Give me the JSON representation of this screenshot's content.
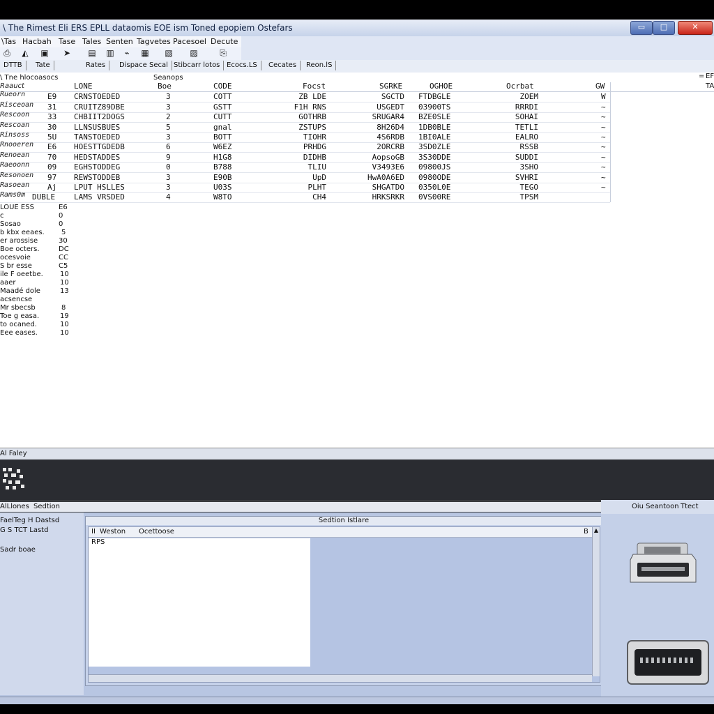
{
  "window": {
    "title": "\\ The Rimest Eli ERS EPLL dataomis EOE ism Toned epopiem Ostefars",
    "buttons": {
      "minimize": "▭",
      "maximize": "□",
      "close": "✕"
    }
  },
  "menu": [
    "\\Tas",
    "Hacbah",
    "Tase",
    "Tales",
    "Senten",
    "Tagvetes",
    "Pacesoel",
    "Decute"
  ],
  "toolbar_icons": [
    "print-icon",
    "pointer-icon",
    "image-icon",
    "arrow-icon",
    "screen-icon",
    "scan-icon",
    "graph-icon",
    "chart-icon",
    "printer-icon"
  ],
  "tabs": [
    "DTTB",
    "Tate",
    "Rates",
    "Dispace Secal",
    "Stibcarr lotos",
    "Ecocs.LS",
    "Cecates",
    "Reon.lS"
  ],
  "header": {
    "left": "\\ Tne hlocoasocs",
    "center": "Seanops",
    "right_marks": [
      "=",
      "EF",
      "TA"
    ]
  },
  "columns": [
    "LONE",
    "Boe",
    "CODE",
    "Focst",
    "SGRKE",
    "OGHOE",
    "Ocrbat",
    "GW"
  ],
  "rows": [
    {
      "label": "Rueorn",
      "n": "E9",
      "code": "CRNSTOEDED",
      "b": "3",
      "c": "COTT",
      "f": "ZB LDE",
      "s": "SGCTD",
      "o": "FTDBGLE",
      "d": "ZOEM",
      "w": "W"
    },
    {
      "label": "Risceoan",
      "n": "31",
      "code": "CRUITZ89DBE",
      "b": "3",
      "c": "GSTT",
      "f": "F1H RNS",
      "s": "USGEDT",
      "o": "03900TS",
      "d": "RRRDI",
      "w": "~"
    },
    {
      "label": "Rescoon",
      "n": "33",
      "code": "CHBIIT2DOGS",
      "b": "2",
      "c": "CUTT",
      "f": "GOTHRB",
      "s": "SRUGAR4",
      "o": "BZE0SLE",
      "d": "SOHAI",
      "w": "~"
    },
    {
      "label": "Rescoan",
      "n": "30",
      "code": "LLNSUSBUES",
      "b": "5",
      "c": "gnal",
      "f": "ZSTUPS",
      "s": "8H26D4",
      "o": "1DB0BLE",
      "d": "TETLI",
      "w": "~"
    },
    {
      "label": "Rinsoss",
      "n": "5U",
      "code": "TANSTOEDED",
      "b": "3",
      "c": "BOTT",
      "f": "TIOHR",
      "s": "4S6RDB",
      "o": "1BI0ALE",
      "d": "EALRO",
      "w": "~"
    },
    {
      "label": "Rnooeren",
      "n": "E6",
      "code": "HOESTTGDEDB",
      "b": "6",
      "c": "W6EZ",
      "f": "PRHDG",
      "s": "2ORCRB",
      "o": "3SD0ZLE",
      "d": "RSSB",
      "w": "~"
    },
    {
      "label": "Renoean",
      "n": "70",
      "code": "HEDSTADDES",
      "b": "9",
      "c": "H1G8",
      "f": "DIDHB",
      "s": "AopsoGB",
      "o": "3S30DDE",
      "d": "SUDDI",
      "w": "~"
    },
    {
      "label": "Raeoonn",
      "n": "09",
      "code": "EGHSTODDEG",
      "b": "0",
      "c": "B788",
      "f": "TLIU",
      "s": "V3493E6",
      "o": "09800JS",
      "d": "3SHO",
      "w": "~"
    },
    {
      "label": "Resonoen",
      "n": "97",
      "code": "REWSTODDEB",
      "b": "3",
      "c": "E90B",
      "f": "UpD",
      "s": "HwA0A6ED",
      "o": "0980ODE",
      "d": "SVHRI",
      "w": "~"
    },
    {
      "label": "Rasoean",
      "n": "Aj",
      "code": "LPUT HSLLES",
      "b": "3",
      "c": "U03S",
      "f": "PLHT",
      "s": "SHGATDO",
      "o": "0350L0E",
      "d": "TEGO",
      "w": "~"
    },
    {
      "label": "Rams0m",
      "n": "DUBLE",
      "code": "LAMS VRSDED",
      "b": "4",
      "c": "W8TO",
      "f": "CH4",
      "s": "HRKSRKR",
      "o": "0VS00RE",
      "d": "TPSM",
      "w": ""
    }
  ],
  "summary": [
    {
      "label": "LOUE ESS",
      "value": "E6"
    },
    {
      "label": "c",
      "value": "0"
    },
    {
      "label": "Sosao",
      "value": "0"
    },
    {
      "label": "b kbx eeaes.",
      "value": "5"
    },
    {
      "label": "er arossise",
      "value": "30"
    },
    {
      "label": "Boe octers.",
      "value": "DC"
    },
    {
      "label": "ocesvoie",
      "value": "CC"
    },
    {
      "label": "S br esse",
      "value": "C5"
    },
    {
      "label": "ile F oeetbe.",
      "value": "10"
    },
    {
      "label": "aaer",
      "value": "10"
    },
    {
      "label": "Maadé dole",
      "value": "13"
    },
    {
      "label": "acsencse",
      "value": ""
    },
    {
      "label": "Mr sbecsb",
      "value": "8"
    },
    {
      "label": "Toe g easa.",
      "value": "19"
    },
    {
      "label": "to ocaned.",
      "value": "10"
    },
    {
      "label": "Eee eases.",
      "value": "10"
    }
  ],
  "status": {
    "text": "Al Faley"
  },
  "lower": {
    "left_header": "AlLlones",
    "left_header2": "Sedtion",
    "left_lines": [
      "FaelTeg H Dastsd",
      "G S    TCT  Lastd",
      "Sadr boae"
    ],
    "panel_caption": "Sedtion Istlare",
    "inner_header_left": "II",
    "inner_header_mid": "Weston",
    "inner_header_right": "Ocettoose",
    "inner_header_end": "B",
    "inner_text": "RPS",
    "right_header": "Oiu Seantoon",
    "right_header2": "Ttect"
  },
  "colors": {
    "accent": "#4d6db4",
    "close": "#c8251a",
    "panel": "#b8c6e2",
    "dark": "#2a2c31"
  }
}
